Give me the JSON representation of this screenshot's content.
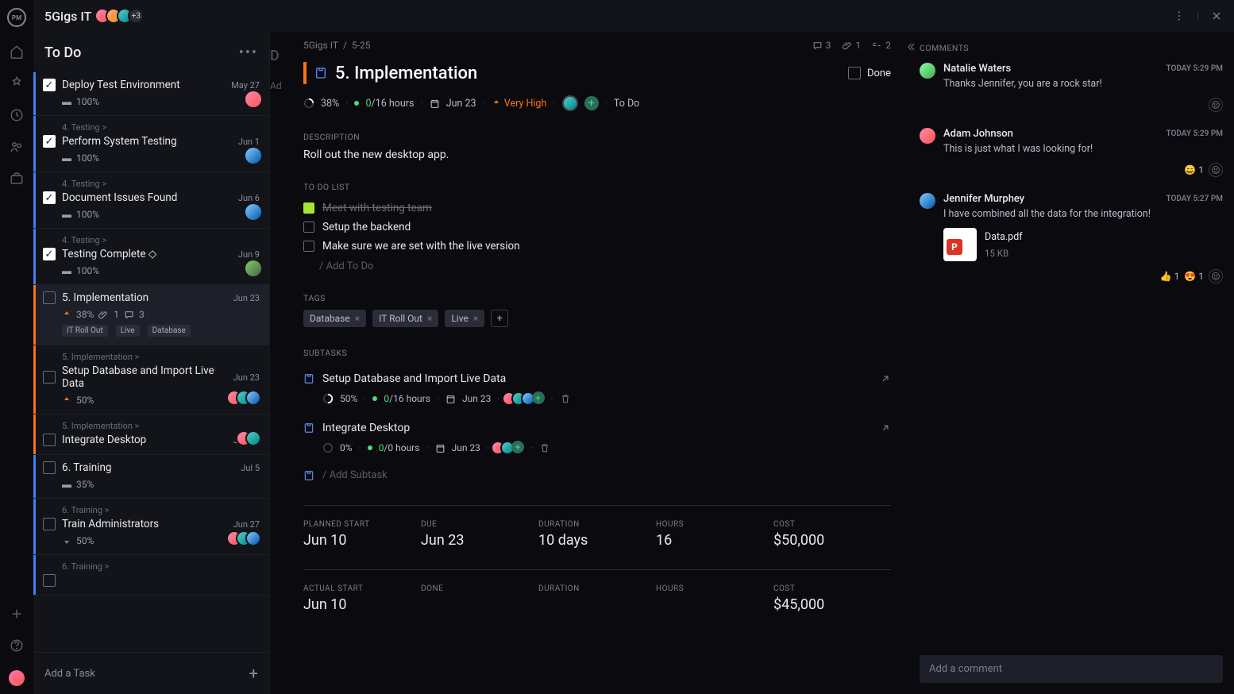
{
  "header": {
    "project_name": "5Gigs IT",
    "avatar_more": "+3"
  },
  "column": {
    "title": "To Do",
    "add_task": "Add a Task"
  },
  "hidden_col": {
    "label": "D",
    "add": "Ad"
  },
  "tasks": [
    {
      "crumb": "",
      "name": "Deploy Test Environment",
      "date": "May 27",
      "done": true,
      "progress": "100%",
      "stripe": "blue"
    },
    {
      "crumb": "4. Testing >",
      "name": "Perform System Testing",
      "date": "Jun 1",
      "done": true,
      "progress": "100%",
      "stripe": "blue"
    },
    {
      "crumb": "4. Testing >",
      "name": "Document Issues Found",
      "date": "Jun 6",
      "done": true,
      "progress": "100%",
      "stripe": "blue"
    },
    {
      "crumb": "4. Testing >",
      "name": "Testing Complete ◇",
      "date": "Jun 9",
      "done": true,
      "progress": "100%",
      "stripe": "blue"
    },
    {
      "crumb": "",
      "name": "5. Implementation",
      "date": "Jun 23",
      "done": false,
      "progress": "38%",
      "stripe": "orange",
      "selected": true,
      "attach": "1",
      "comments": "3",
      "tags": [
        "IT Roll Out",
        "Live",
        "Database"
      ]
    },
    {
      "crumb": "5. Implementation >",
      "name": "Setup Database and Import Live Data",
      "date": "Jun 23",
      "done": false,
      "progress": "50%",
      "stripe": "orange"
    },
    {
      "crumb": "5. Implementation >",
      "name": "Integrate Desktop",
      "date": "Jun 23",
      "done": false,
      "progress": "",
      "stripe": "orange"
    },
    {
      "crumb": "",
      "name": "6. Training",
      "date": "Jul 5",
      "done": false,
      "progress": "35%",
      "stripe": "blue"
    },
    {
      "crumb": "6. Training >",
      "name": "Train Administrators",
      "date": "Jun 27",
      "done": false,
      "progress": "50%",
      "stripe": "blue"
    },
    {
      "crumb": "6. Training >",
      "name": "",
      "date": "",
      "done": false,
      "progress": "",
      "stripe": "blue"
    }
  ],
  "detail": {
    "breadcrumb": {
      "project": "5Gigs IT",
      "section": "5-25"
    },
    "counters": {
      "comments": "3",
      "attachments": "1",
      "subtasks": "2"
    },
    "title": "5. Implementation",
    "done_label": "Done",
    "meta": {
      "progress": "38%",
      "hours_done": "0",
      "hours_total": "/16 hours",
      "due": "Jun 23",
      "priority": "Very High",
      "status": "To Do"
    },
    "section_desc": "DESCRIPTION",
    "description": "Roll out the new desktop app.",
    "section_todo": "TO DO LIST",
    "todos": [
      {
        "text": "Meet with testing team",
        "done": true
      },
      {
        "text": "Setup the backend",
        "done": false
      },
      {
        "text": "Make sure we are set with the live version",
        "done": false
      }
    ],
    "todo_add": "/ Add To Do",
    "section_tags": "TAGS",
    "tags": [
      "Database",
      "IT Roll Out",
      "Live"
    ],
    "section_subtasks": "SUBTASKS",
    "subtasks": [
      {
        "name": "Setup Database and Import Live Data",
        "progress": "50%",
        "hours_done": "0",
        "hours_total": "/16 hours",
        "due": "Jun 23"
      },
      {
        "name": "Integrate Desktop",
        "progress": "0%",
        "hours_done": "0",
        "hours_total": "/0 hours",
        "due": "Jun 23"
      }
    ],
    "subtask_add": "/ Add Subtask",
    "planned": {
      "start_lbl": "PLANNED START",
      "start": "Jun 10",
      "due_lbl": "DUE",
      "due": "Jun 23",
      "duration_lbl": "DURATION",
      "duration": "10 days",
      "hours_lbl": "HOURS",
      "hours": "16",
      "cost_lbl": "COST",
      "cost": "$50,000"
    },
    "actual": {
      "start_lbl": "ACTUAL START",
      "start": "Jun 10",
      "done_lbl": "DONE",
      "done": "",
      "duration_lbl": "DURATION",
      "duration": "",
      "hours_lbl": "HOURS",
      "hours": "",
      "cost_lbl": "COST",
      "cost": "$45,000"
    }
  },
  "comments": {
    "label": "COMMENTS",
    "items": [
      {
        "name": "Natalie Waters",
        "time": "TODAY 5:29 PM",
        "text": "Thanks Jennifer, you are a rock star!",
        "reactions": []
      },
      {
        "name": "Adam Johnson",
        "time": "TODAY 5:29 PM",
        "text": "This is just what I was looking for!",
        "reactions": [
          "😄 1"
        ]
      },
      {
        "name": "Jennifer Murphey",
        "time": "TODAY 5:27 PM",
        "text": "I have combined all the data for the integration!",
        "reactions": [
          "👍 1",
          "😍 1"
        ],
        "attachment": {
          "name": "Data.pdf",
          "size": "15 KB"
        }
      }
    ],
    "input_placeholder": "Add a comment"
  }
}
